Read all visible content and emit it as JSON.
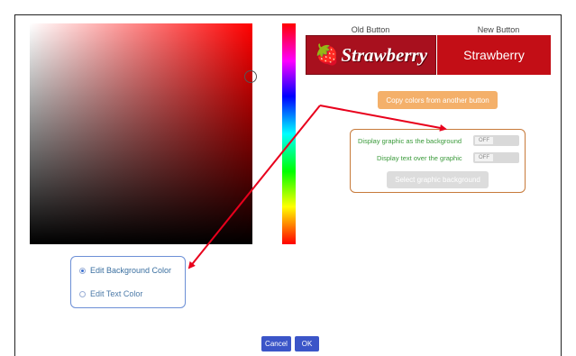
{
  "preview": {
    "old_label": "Old Button",
    "new_label": "New Button",
    "old_button_text": "Strawberry",
    "old_button_icon": "strawberry-graphic",
    "new_button_text": "Strawberry"
  },
  "actions": {
    "copy_colors": "Copy colors from another button",
    "select_graphic": "Select graphic background",
    "cancel": "Cancel",
    "ok": "OK"
  },
  "graphic_options": {
    "display_graphic_label": "Display graphic as the background",
    "display_graphic_state": "OFF",
    "display_text_label": "Display text over the graphic",
    "display_text_state": "OFF"
  },
  "edit_target": {
    "background_label": "Edit Background Color",
    "text_label": "Edit Text Color",
    "selected": "background"
  },
  "colors": {
    "selected_hue": "#ff0000",
    "new_button_bg": "#c30e16",
    "annotation_arrow": "#e8001c"
  }
}
